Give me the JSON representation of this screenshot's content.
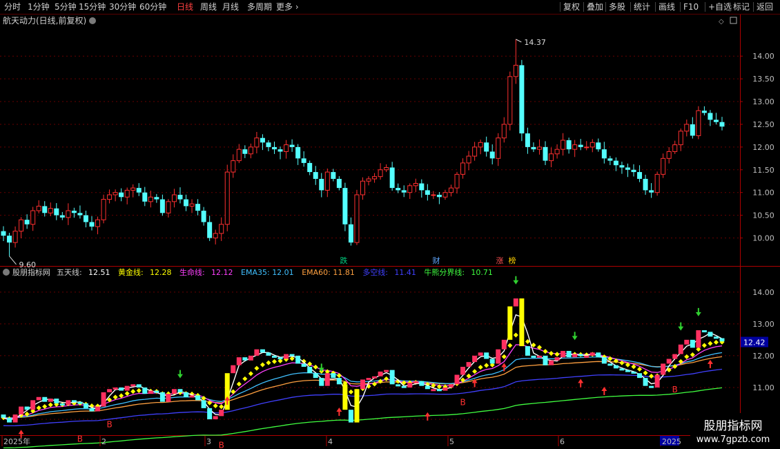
{
  "toolbar": {
    "periods": [
      "分时",
      "1分钟",
      "5分钟",
      "15分钟",
      "30分钟",
      "60分钟",
      "日线",
      "周线",
      "月线",
      "多周期",
      "更多"
    ],
    "active_period": "日线",
    "actions": [
      "复权",
      "叠加",
      "多股",
      "统计",
      "画线",
      "F10",
      "+自选",
      "标记",
      "返回"
    ]
  },
  "main_panel": {
    "title": "航天动力(日线,前复权)",
    "price_axis": [
      "14.00",
      "13.50",
      "13.00",
      "12.50",
      "12.00",
      "11.50",
      "11.00",
      "10.50",
      "10.00"
    ],
    "high_label": "14.37",
    "low_label": "9.60",
    "markers": [
      {
        "text": "跌",
        "color": "#00d080"
      },
      {
        "text": "财",
        "color": "#60a8ff"
      },
      {
        "text": "涨",
        "color": "#ff5050"
      },
      {
        "text": "榜",
        "color": "#ffd000"
      }
    ]
  },
  "indicator_panel": {
    "name": "股朋指标网",
    "lines": [
      {
        "label": "五天线:",
        "value": "12.51",
        "color": "#ffffff"
      },
      {
        "label": "黄金线:",
        "value": "12.28",
        "color": "#ffff00"
      },
      {
        "label": "生命线:",
        "value": "12.12",
        "color": "#ff40ff"
      },
      {
        "label": "EMA35:",
        "value": "12.01",
        "color": "#40c0ff"
      },
      {
        "label": "EMA60:",
        "value": "11.81",
        "color": "#ffa040"
      },
      {
        "label": "多空线:",
        "value": "11.41",
        "color": "#4040ff"
      },
      {
        "label": "牛熊分界线:",
        "value": "10.71",
        "color": "#40ff40"
      }
    ],
    "price_axis": [
      "14.00",
      "13.00",
      "12.00",
      "11.00",
      "10.00"
    ],
    "current_price": "12.42",
    "b_marker": "B"
  },
  "date_axis": {
    "labels": [
      "2025年",
      "2",
      "3",
      "4",
      "5",
      "6",
      "2025"
    ]
  },
  "watermark": {
    "line1": "股朋指标网",
    "line2": "www.7gpzb.com"
  },
  "colors": {
    "up": "#ff3030",
    "down": "#54ffff",
    "border": "#b00000",
    "axis_text": "#c0c0c0"
  },
  "chart_data": [
    {
      "type": "candlestick",
      "title": "航天动力(日线,前复权)",
      "ylim": [
        9.4,
        14.9
      ],
      "high": 14.37,
      "low": 9.6,
      "close_series": [
        10.05,
        9.9,
        10.15,
        10.4,
        10.3,
        10.6,
        10.7,
        10.55,
        10.65,
        10.5,
        10.45,
        10.6,
        10.55,
        10.5,
        10.35,
        10.25,
        10.4,
        10.85,
        10.95,
        11.0,
        10.9,
        11.05,
        11.1,
        11.0,
        10.8,
        10.9,
        10.85,
        10.55,
        10.8,
        10.95,
        10.85,
        10.7,
        10.75,
        10.6,
        10.35,
        10.0,
        10.1,
        10.3,
        11.45,
        11.7,
        11.95,
        11.85,
        12.0,
        12.2,
        12.1,
        12.0,
        11.95,
        11.9,
        12.05,
        12.0,
        11.75,
        11.65,
        11.45,
        11.3,
        11.05,
        11.45,
        11.3,
        11.1,
        10.3,
        9.9,
        10.95,
        11.25,
        11.3,
        11.35,
        11.5,
        11.55,
        11.1,
        11.05,
        11.0,
        11.15,
        11.2,
        11.05,
        10.95,
        10.95,
        10.9,
        11.0,
        11.1,
        11.4,
        11.65,
        11.8,
        12.0,
        12.1,
        11.9,
        11.75,
        12.2,
        12.5,
        13.55,
        13.8,
        12.3,
        12.0,
        11.95,
        12.0,
        11.7,
        11.85,
        11.95,
        12.15,
        11.95,
        12.05,
        12.0,
        12.0,
        12.1,
        11.95,
        11.75,
        11.7,
        11.6,
        11.55,
        11.5,
        11.45,
        11.3,
        11.05,
        11.0,
        11.4,
        11.75,
        11.9,
        12.05,
        12.35,
        12.5,
        12.25,
        12.8,
        12.75,
        12.6,
        12.55,
        12.45
      ]
    },
    {
      "type": "line",
      "title": "股朋指标网",
      "ylim": [
        9.5,
        14.8
      ],
      "series": [
        {
          "name": "五天线",
          "value": 12.51
        },
        {
          "name": "黄金线",
          "value": 12.28
        },
        {
          "name": "生命线",
          "value": 12.12
        },
        {
          "name": "EMA35",
          "value": 12.01
        },
        {
          "name": "EMA60",
          "value": 11.81
        },
        {
          "name": "多空线",
          "value": 11.41
        },
        {
          "name": "牛熊分界线",
          "value": 10.71
        }
      ],
      "last_price": 12.42
    }
  ]
}
